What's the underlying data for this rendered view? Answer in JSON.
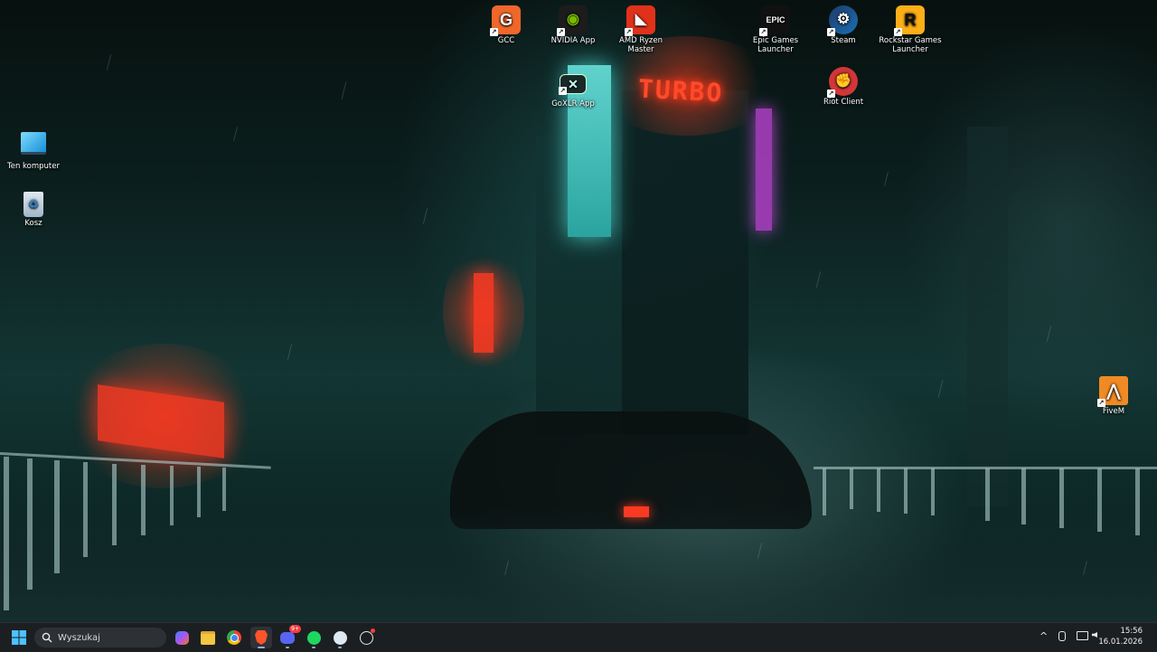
{
  "desktop": {
    "wallpaper": {
      "signs": {
        "turbo": "TURBO"
      }
    },
    "icons": [
      {
        "label": "GCC",
        "icon": "gcc-icon",
        "color": "#f0672b"
      },
      {
        "label": "NVIDIA App",
        "icon": "nvidia-icon",
        "color": "#76b900"
      },
      {
        "label": "AMD Ryzen Master",
        "icon": "amd-ryzen-master-icon",
        "color": "#e0321a"
      },
      {
        "label": "Epic Games Launcher",
        "icon": "epic-games-icon",
        "color": "#111111"
      },
      {
        "label": "Steam",
        "icon": "steam-icon",
        "color": "#1b6fb3"
      },
      {
        "label": "Rockstar Games Launcher",
        "icon": "rockstar-icon",
        "color": "#fcaf17"
      },
      {
        "label": "GoXLR App",
        "icon": "goxlr-icon",
        "color": "#1a2a2a"
      },
      {
        "label": "Riot Client",
        "icon": "riot-client-icon",
        "color": "#d13639"
      },
      {
        "label": "Ten komputer",
        "icon": "this-pc-icon",
        "color": "#4fc3f7"
      },
      {
        "label": "Kosz",
        "icon": "recycle-bin-icon",
        "color": "#9fb7c8"
      },
      {
        "label": "FiveM",
        "icon": "fivem-icon",
        "color": "#f08a24"
      }
    ]
  },
  "taskbar": {
    "search_placeholder": "Wyszukaj",
    "apps": [
      "copilot-icon",
      "file-explorer-icon",
      "chrome-icon",
      "brave-icon",
      "discord-icon",
      "spotify-icon",
      "steam-icon",
      "chatgpt-icon"
    ],
    "discord_badge": "9+",
    "tray": {
      "chevron": "^"
    },
    "clock": {
      "time": "15:56",
      "date": "16.01.2026"
    }
  }
}
